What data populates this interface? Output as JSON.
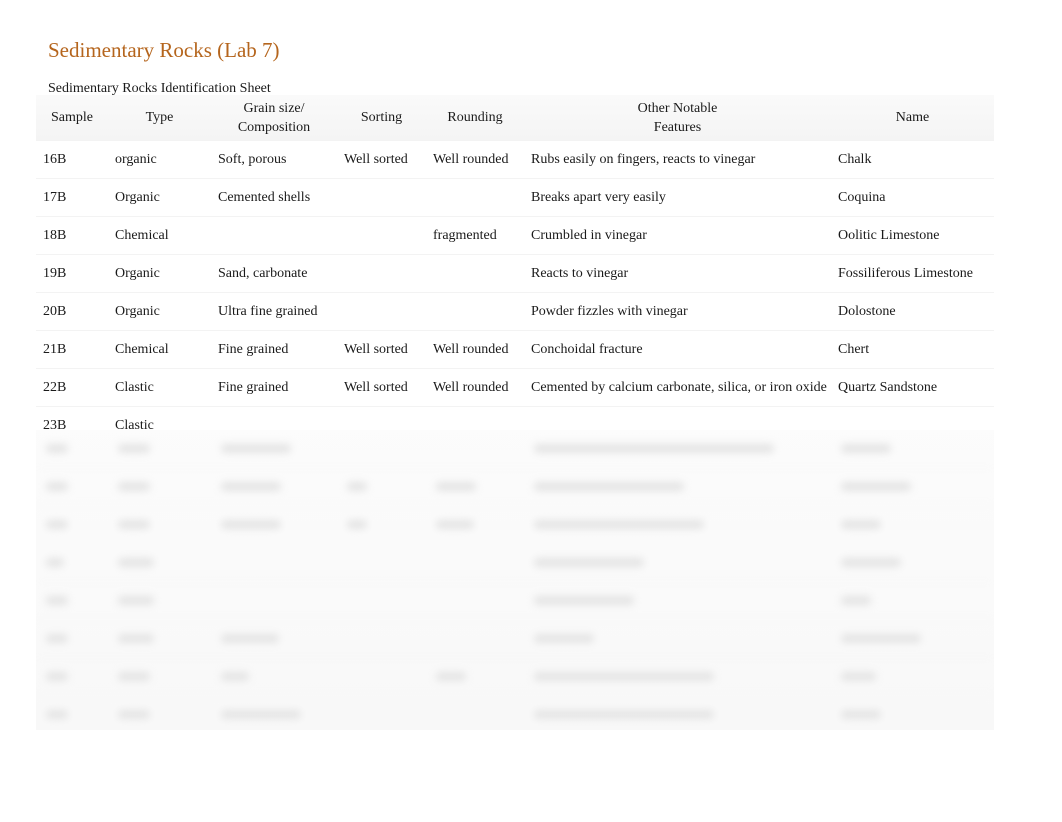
{
  "document": {
    "title": "Sedimentary Rocks (Lab 7)",
    "subtitle": "Sedimentary Rocks Identification Sheet",
    "title_color": "#b5651d"
  },
  "table": {
    "headers": {
      "sample": "Sample",
      "type": "Type",
      "grain_line1": "Grain size/",
      "grain_line2": "Composition",
      "sorting": "Sorting",
      "rounding": "Rounding",
      "features_line1": "Other Notable",
      "features_line2": "Features",
      "name": "Name"
    },
    "rows": [
      {
        "sample": "16B",
        "type": "organic",
        "grain": "Soft, porous",
        "sorting": "Well sorted",
        "rounding": "Well rounded",
        "features": "Rubs easily on fingers, reacts to vinegar",
        "name": "Chalk"
      },
      {
        "sample": "17B",
        "type": "Organic",
        "grain": "Cemented shells",
        "sorting": "",
        "rounding": "",
        "features": "Breaks apart very easily",
        "name": "Coquina"
      },
      {
        "sample": "18B",
        "type": "Chemical",
        "grain": "",
        "sorting": "",
        "rounding": "fragmented",
        "features": "Crumbled in vinegar",
        "name": "Oolitic Limestone"
      },
      {
        "sample": "19B",
        "type": "Organic",
        "grain": "Sand, carbonate",
        "sorting": "",
        "rounding": "",
        "features": "Reacts to vinegar",
        "name": "Fossiliferous Limestone"
      },
      {
        "sample": "20B",
        "type": "Organic",
        "grain": "Ultra fine grained",
        "sorting": "",
        "rounding": "",
        "features": "Powder fizzles with vinegar",
        "name": "Dolostone"
      },
      {
        "sample": "21B",
        "type": "Chemical",
        "grain": "Fine grained",
        "sorting": "Well sorted",
        "rounding": "Well rounded",
        "features": "Conchoidal fracture",
        "name": "Chert"
      },
      {
        "sample": "22B",
        "type": "Clastic",
        "grain": "Fine grained",
        "sorting": "Well sorted",
        "rounding": "Well rounded",
        "features": "Cemented by calcium carbonate, silica, or iron oxide",
        "name": "Quartz Sandstone"
      },
      {
        "sample": "23B",
        "type": "Clastic",
        "grain": "",
        "sorting": "",
        "rounding": "",
        "features": "",
        "name": ""
      }
    ],
    "blurred_row_count": 8
  }
}
